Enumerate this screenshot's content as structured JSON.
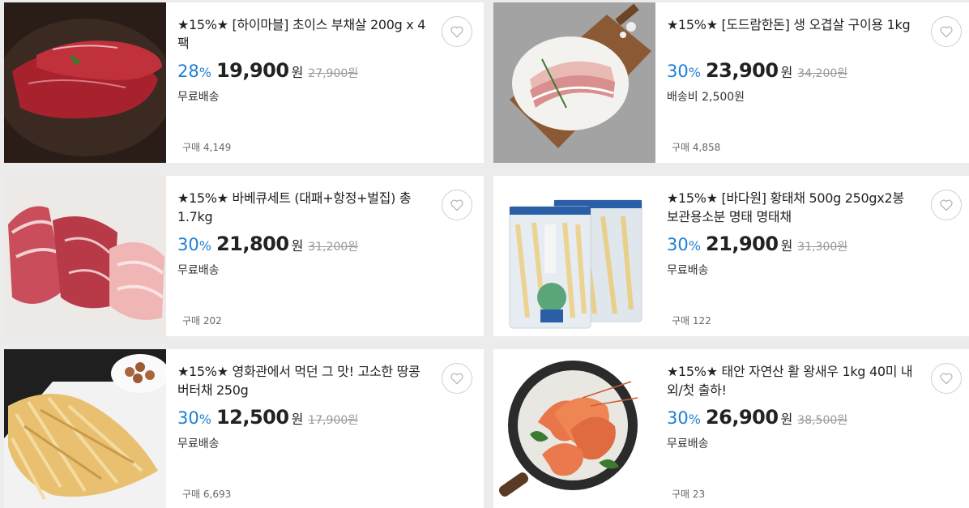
{
  "products": [
    {
      "title": "★15%★ [하이마블] 초이스 부채살 200g x 4팩",
      "discount": "28",
      "pct": "%",
      "price": "19,900",
      "unit": "원",
      "original": "27,900원",
      "shipping": "무료배송",
      "sold": "구매 4,149",
      "image": "beef-steak-image"
    },
    {
      "title": "★15%★ [도드람한돈] 생 오겹살 구이용 1kg",
      "discount": "30",
      "pct": "%",
      "price": "23,900",
      "unit": "원",
      "original": "34,200원",
      "shipping": "배송비 2,500원",
      "sold": "구매 4,858",
      "image": "pork-belly-image"
    },
    {
      "title": "★15%★ 바베큐세트 (대패+항정+벌집) 총 1.7kg",
      "discount": "30",
      "pct": "%",
      "price": "21,800",
      "unit": "원",
      "original": "31,200원",
      "shipping": "무료배송",
      "sold": "구매 202",
      "image": "bbq-set-image"
    },
    {
      "title": "★15%★ [바다원] 황태채 500g 250gx2봉 보관용소분 명태 명태채",
      "discount": "30",
      "pct": "%",
      "price": "21,900",
      "unit": "원",
      "original": "31,300원",
      "shipping": "무료배송",
      "sold": "구매 122",
      "image": "dried-pollack-image"
    },
    {
      "title": "★15%★ 영화관에서 먹던 그 맛! 고소한 땅콩버터채 250g",
      "discount": "30",
      "pct": "%",
      "price": "12,500",
      "unit": "원",
      "original": "17,900원",
      "shipping": "무료배송",
      "sold": "구매 6,693",
      "image": "shredded-squid-image"
    },
    {
      "title": "★15%★ 태안 자연산 활 왕새우 1kg 40미 내외/첫 출하!",
      "discount": "30",
      "pct": "%",
      "price": "26,900",
      "unit": "원",
      "original": "38,500원",
      "shipping": "무료배송",
      "sold": "구매 23",
      "image": "king-prawn-image"
    }
  ],
  "colors": {
    "discount": "#1e7fd6",
    "background": "#ececec"
  }
}
